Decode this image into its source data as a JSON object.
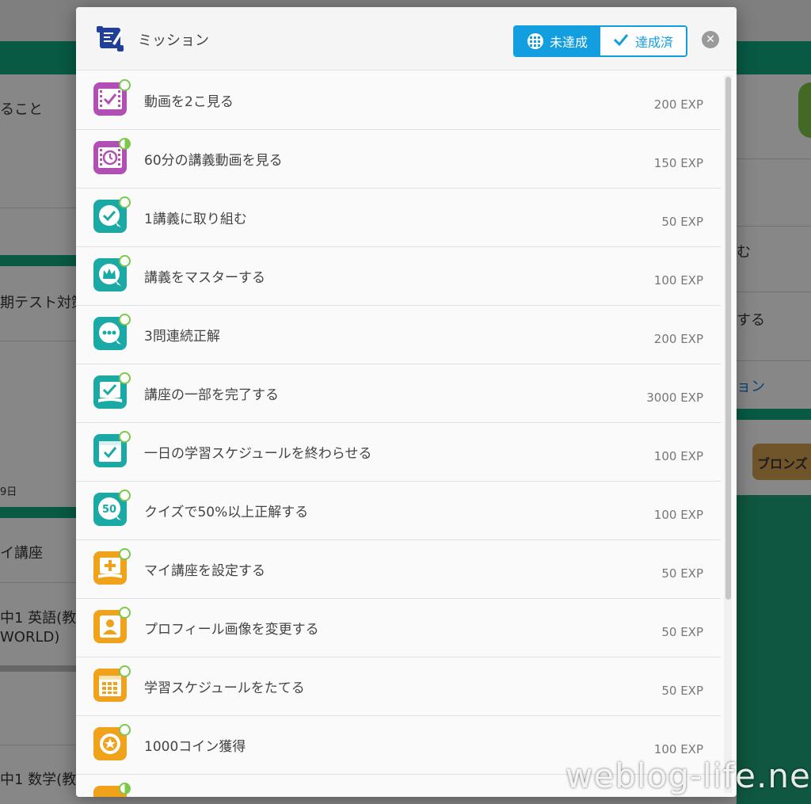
{
  "background": {
    "left_texts": [
      "ること",
      "期テスト対策",
      "9日",
      "イ講座",
      "中1 英語(教",
      "WORLD)",
      "中1 数学(教"
    ],
    "right_texts": [
      "む",
      "する",
      "ョン"
    ],
    "bronze_label": "ブロンズ"
  },
  "modal": {
    "title": "ミッション",
    "tabs": [
      {
        "label": "未達成",
        "icon": "grid-icon",
        "active": true
      },
      {
        "label": "達成済",
        "icon": "check-icon",
        "active": false
      }
    ],
    "close_icon": "close-icon",
    "missions": [
      {
        "label": "動画を2こ見る",
        "exp": "200 EXP",
        "icon": "video-check-icon",
        "color": "purple",
        "progress": "none"
      },
      {
        "label": "60分の講義動画を見る",
        "exp": "150 EXP",
        "icon": "video-clock-icon",
        "color": "purple",
        "progress": "partial"
      },
      {
        "label": "1講義に取り組む",
        "exp": "50 EXP",
        "icon": "quiz-check-icon",
        "color": "teal",
        "progress": "none"
      },
      {
        "label": "講義をマスターする",
        "exp": "100 EXP",
        "icon": "crown-icon",
        "color": "teal",
        "progress": "none"
      },
      {
        "label": "3問連続正解",
        "exp": "200 EXP",
        "icon": "chat-dots-icon",
        "color": "teal",
        "progress": "none"
      },
      {
        "label": "講座の一部を完了する",
        "exp": "3000 EXP",
        "icon": "book-check-icon",
        "color": "teal",
        "progress": "none"
      },
      {
        "label": "一日の学習スケジュールを終わらせる",
        "exp": "100 EXP",
        "icon": "calendar-check-icon",
        "color": "teal",
        "progress": "none"
      },
      {
        "label": "クイズで50%以上正解する",
        "exp": "100 EXP",
        "icon": "fifty-percent-icon",
        "icon_text": "50",
        "color": "teal",
        "progress": "none"
      },
      {
        "label": "マイ講座を設定する",
        "exp": "50 EXP",
        "icon": "book-plus-icon",
        "color": "orange",
        "progress": "none"
      },
      {
        "label": "プロフィール画像を変更する",
        "exp": "50 EXP",
        "icon": "profile-icon",
        "color": "orange",
        "progress": "none"
      },
      {
        "label": "学習スケジュールをたてる",
        "exp": "50 EXP",
        "icon": "calendar-grid-icon",
        "color": "orange",
        "progress": "none"
      },
      {
        "label": "1000コイン獲得",
        "exp": "100 EXP",
        "icon": "coin-star-icon",
        "color": "orange",
        "progress": "none"
      },
      {
        "label": "",
        "exp": "",
        "icon": "partial-icon",
        "color": "orange",
        "progress": "partial"
      }
    ]
  },
  "watermark": "weblog-life.net",
  "colors": {
    "accent_blue": "#139ee0",
    "green": "#0ea47c",
    "progress_green": "#7bc94a"
  }
}
